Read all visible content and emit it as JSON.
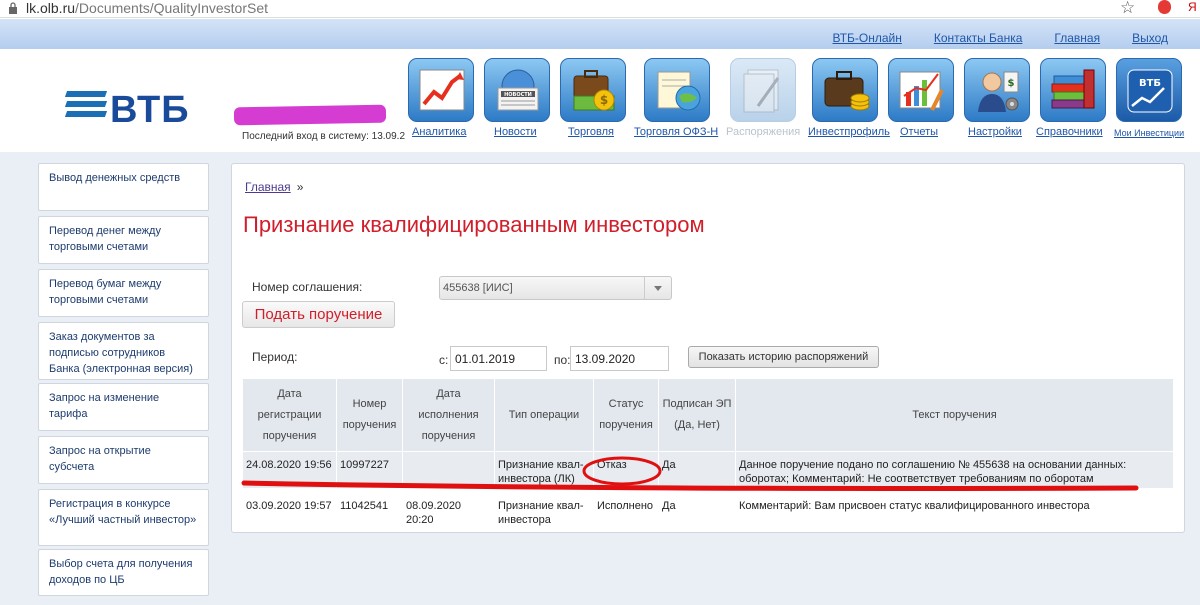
{
  "browser": {
    "url_host": "lk.olb.ru",
    "url_path": "/Documents/QualityInvestorSet"
  },
  "toplinks": [
    "ВТБ-Онлайн",
    "Контакты Банка",
    "Главная",
    "Выход"
  ],
  "header": {
    "logo_text": "ВТБ",
    "last_login": "Последний вход в систему: 13.09.2"
  },
  "toolbar": [
    {
      "label": "Аналитика"
    },
    {
      "label": "Новости"
    },
    {
      "label": "Торговля"
    },
    {
      "label": "Торговля ОФЗ-Н"
    },
    {
      "label": "Распоряжения"
    },
    {
      "label": "Инвестпрофиль"
    },
    {
      "label": "Отчеты"
    },
    {
      "label": "Настройки"
    },
    {
      "label": "Справочники"
    },
    {
      "label": "Мои Инвестиции"
    }
  ],
  "icon_texts": {
    "news": "НОВОСТИ",
    "vtb": "ВТБ"
  },
  "sidebar": [
    "Вывод денежных средств",
    "Перевод денег между торговыми счетами",
    "Перевод бумаг между торговыми счетами",
    "Заказ документов за подписью сотрудников Банка (электронная версия)",
    "Запрос на изменение тарифа",
    "Запрос на открытие субсчета",
    "Регистрация в конкурсе «Лучший частный инвестор»",
    "Выбор счета для получения доходов по ЦБ"
  ],
  "main": {
    "breadcrumb": "Главная",
    "breadcrumb_sep": "»",
    "title": "Признание квалифицированным инвестором",
    "agreement_label": "Номер соглашения:",
    "agreement_value": "455638 [ИИС]",
    "submit_label": "Подать поручение",
    "period_label": "Период:",
    "from_label": "с:",
    "from_value": "01.01.2019",
    "to_label": "по:",
    "to_value": "13.09.2020",
    "history_button": "Показать историю распоряжений"
  },
  "table": {
    "headers": [
      "Дата регистрации поручения",
      "Номер поручения",
      "Дата исполнения поручения",
      "Тип операции",
      "Статус поручения",
      "Подписан ЭП (Да, Нет)",
      "Текст поручения"
    ],
    "rows": [
      [
        "24.08.2020 19:56",
        "10997227",
        "",
        "Признание квал-инвестора (ЛК)",
        "Отказ",
        "Да",
        "Данное поручение подано по соглашению № 455638 на основании данных: оборотах; Комментарий: Не соответствует требованиям по оборотам"
      ],
      [
        "03.09.2020 19:57",
        "11042541",
        "08.09.2020 20:20",
        "Признание квал-инвестора",
        "Исполнено",
        "Да",
        "Комментарий: Вам присвоен статус квалифицированного инвестора"
      ]
    ]
  },
  "colors": {
    "title_red": "#d01e2a",
    "link_blue": "#1f56a8",
    "logo_blue": "#1a4b9b",
    "annotation_red": "#e01010"
  }
}
